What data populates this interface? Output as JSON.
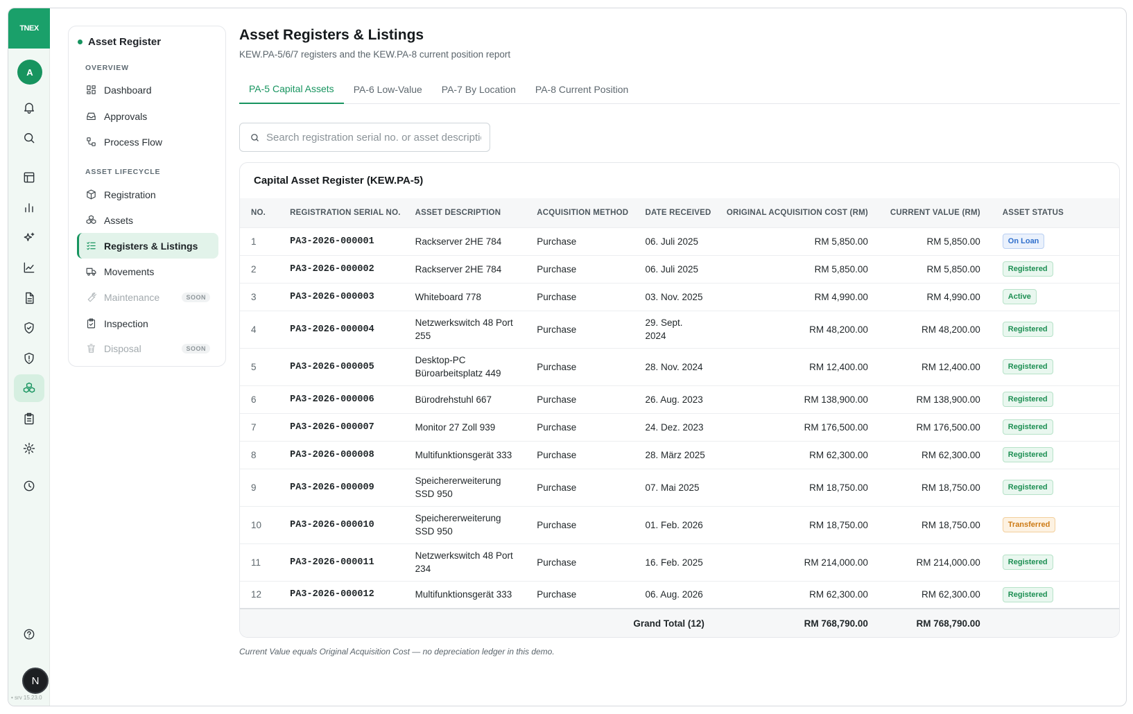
{
  "rail": {
    "logo": "TNEX",
    "avatar": "A",
    "user_initial": "N",
    "version": "• srv 15.23.0",
    "icons": [
      "bell-icon",
      "search-icon",
      "table-icon",
      "bar-chart-icon",
      "sparkle-icon",
      "line-chart-icon",
      "document-icon",
      "shield-check-icon",
      "shield-alert-icon",
      "cubes-icon",
      "clipboard-icon",
      "gear-icon",
      "clock-icon",
      "help-icon"
    ],
    "active_icon": "cubes-icon"
  },
  "subnav": {
    "title": "Asset Register",
    "sections": [
      {
        "label": "OVERVIEW",
        "items": [
          {
            "label": "Dashboard",
            "icon": "grid-icon"
          },
          {
            "label": "Approvals",
            "icon": "inbox-icon"
          },
          {
            "label": "Process Flow",
            "icon": "flow-icon"
          }
        ]
      },
      {
        "label": "ASSET LIFECYCLE",
        "items": [
          {
            "label": "Registration",
            "icon": "box-icon"
          },
          {
            "label": "Assets",
            "icon": "cubes-icon"
          },
          {
            "label": "Registers & Listings",
            "icon": "list-check-icon",
            "active": true
          },
          {
            "label": "Movements",
            "icon": "truck-icon"
          },
          {
            "label": "Maintenance",
            "icon": "wrench-icon",
            "badge": "SOON",
            "disabled": true
          },
          {
            "label": "Inspection",
            "icon": "clipboard-check-icon"
          },
          {
            "label": "Disposal",
            "icon": "trash-icon",
            "badge": "SOON",
            "disabled": true
          }
        ]
      }
    ]
  },
  "header": {
    "title": "Asset Registers & Listings",
    "subtitle": "KEW.PA-5/6/7 registers and the KEW.PA-8 current position report"
  },
  "tabs": [
    {
      "label": "PA-5 Capital Assets",
      "active": true
    },
    {
      "label": "PA-6 Low-Value"
    },
    {
      "label": "PA-7 By Location"
    },
    {
      "label": "PA-8 Current Position"
    }
  ],
  "search": {
    "placeholder": "Search registration serial no. or asset description",
    "value": ""
  },
  "register": {
    "title": "Capital Asset Register (KEW.PA-5)",
    "columns": [
      "NO.",
      "REGISTRATION SERIAL NO.",
      "ASSET DESCRIPTION",
      "ACQUISITION METHOD",
      "DATE RECEIVED",
      "ORIGINAL ACQUISITION COST (RM)",
      "CURRENT VALUE (RM)",
      "ASSET STATUS"
    ],
    "rows": [
      {
        "no": "1",
        "serial": "PA3-2026-000001",
        "desc": [
          "Rackserver 2HE 784"
        ],
        "method": "Purchase",
        "date": [
          "06. Juli 2025"
        ],
        "cost": "RM 5,850.00",
        "value": "RM 5,850.00",
        "status": "On Loan"
      },
      {
        "no": "2",
        "serial": "PA3-2026-000002",
        "desc": [
          "Rackserver 2HE 784"
        ],
        "method": "Purchase",
        "date": [
          "06. Juli 2025"
        ],
        "cost": "RM 5,850.00",
        "value": "RM 5,850.00",
        "status": "Registered"
      },
      {
        "no": "3",
        "serial": "PA3-2026-000003",
        "desc": [
          "Whiteboard 778"
        ],
        "method": "Purchase",
        "date": [
          "03. Nov. 2025"
        ],
        "cost": "RM 4,990.00",
        "value": "RM 4,990.00",
        "status": "Active"
      },
      {
        "no": "4",
        "serial": "PA3-2026-000004",
        "desc": [
          "Netzwerkswitch 48 Port",
          "255"
        ],
        "method": "Purchase",
        "date": [
          "29. Sept.",
          "2024"
        ],
        "cost": "RM 48,200.00",
        "value": "RM 48,200.00",
        "status": "Registered"
      },
      {
        "no": "5",
        "serial": "PA3-2026-000005",
        "desc": [
          "Desktop-PC",
          "Büroarbeitsplatz 449"
        ],
        "method": "Purchase",
        "date": [
          "28. Nov. 2024"
        ],
        "cost": "RM 12,400.00",
        "value": "RM 12,400.00",
        "status": "Registered"
      },
      {
        "no": "6",
        "serial": "PA3-2026-000006",
        "desc": [
          "Bürodrehstuhl 667"
        ],
        "method": "Purchase",
        "date": [
          "26. Aug. 2023"
        ],
        "cost": "RM 138,900.00",
        "value": "RM 138,900.00",
        "status": "Registered"
      },
      {
        "no": "7",
        "serial": "PA3-2026-000007",
        "desc": [
          "Monitor 27 Zoll 939"
        ],
        "method": "Purchase",
        "date": [
          "24. Dez. 2023"
        ],
        "cost": "RM 176,500.00",
        "value": "RM 176,500.00",
        "status": "Registered"
      },
      {
        "no": "8",
        "serial": "PA3-2026-000008",
        "desc": [
          "Multifunktionsgerät 333"
        ],
        "method": "Purchase",
        "date": [
          "28. März 2025"
        ],
        "cost": "RM 62,300.00",
        "value": "RM 62,300.00",
        "status": "Registered"
      },
      {
        "no": "9",
        "serial": "PA3-2026-000009",
        "desc": [
          "Speichererweiterung",
          "SSD 950"
        ],
        "method": "Purchase",
        "date": [
          "07. Mai 2025"
        ],
        "cost": "RM 18,750.00",
        "value": "RM 18,750.00",
        "status": "Registered"
      },
      {
        "no": "10",
        "serial": "PA3-2026-000010",
        "desc": [
          "Speichererweiterung",
          "SSD 950"
        ],
        "method": "Purchase",
        "date": [
          "01. Feb. 2026"
        ],
        "cost": "RM 18,750.00",
        "value": "RM 18,750.00",
        "status": "Transferred"
      },
      {
        "no": "11",
        "serial": "PA3-2026-000011",
        "desc": [
          "Netzwerkswitch 48 Port",
          "234"
        ],
        "method": "Purchase",
        "date": [
          "16. Feb. 2025"
        ],
        "cost": "RM 214,000.00",
        "value": "RM 214,000.00",
        "status": "Registered"
      },
      {
        "no": "12",
        "serial": "PA3-2026-000012",
        "desc": [
          "Multifunktionsgerät 333"
        ],
        "method": "Purchase",
        "date": [
          "06. Aug. 2026"
        ],
        "cost": "RM 62,300.00",
        "value": "RM 62,300.00",
        "status": "Registered"
      }
    ],
    "total": {
      "label": "Grand Total (12)",
      "cost": "RM 768,790.00",
      "value": "RM 768,790.00"
    },
    "status_colors": {
      "On Loan": "#2f6fcc",
      "Registered": "#1d8f53",
      "Active": "#1d8f53",
      "Transferred": "#cc7a14"
    }
  },
  "footnote": "Current Value equals Original Acquisition Cost — no depreciation ledger in this demo.",
  "colors": {
    "accent": "#17945f",
    "logo_bg": "#1aa06a",
    "rail_bg": "#f1f8f4"
  }
}
